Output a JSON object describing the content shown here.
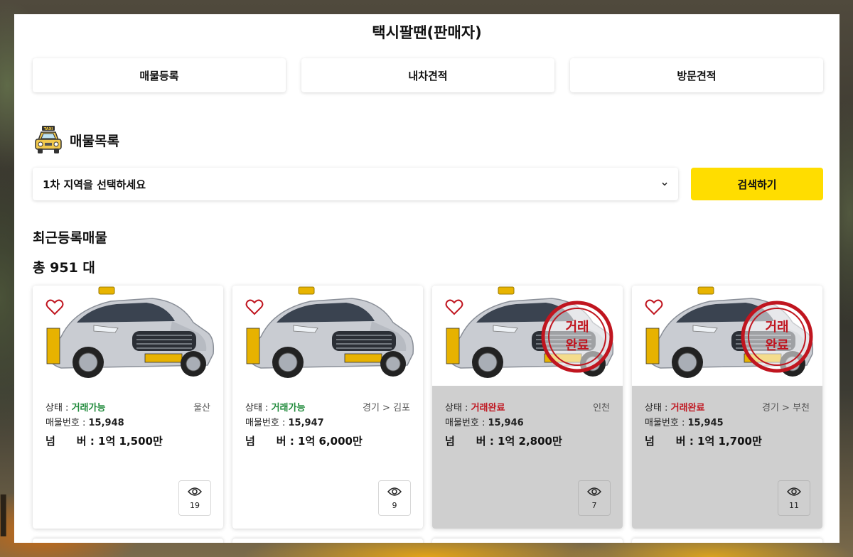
{
  "header": {
    "title": "택시팔땐(판매자)"
  },
  "tabs": [
    {
      "label": "매물등록"
    },
    {
      "label": "내차견적"
    },
    {
      "label": "방문견적"
    }
  ],
  "listing_section": {
    "title": "매물목록",
    "icon": "taxi-icon"
  },
  "filter": {
    "region_selected": "1차 지역을 선택하세요",
    "search_label": "검색하기"
  },
  "recent": {
    "title": "최근등록매물",
    "total_label": "총 951 대"
  },
  "labels": {
    "status": "상태 : ",
    "listing_no": "매물번호 : ",
    "plate": "넘　　버 : "
  },
  "stamp_text": {
    "line1": "거래",
    "line2": "완료"
  },
  "cards": [
    {
      "status": "거래가능",
      "region": "울산",
      "listing_no": "15,948",
      "price": "1억 1,500만",
      "views": "19",
      "sold": false
    },
    {
      "status": "거래가능",
      "region": "경기 > 김포",
      "listing_no": "15,947",
      "price": "1억 6,000만",
      "views": "9",
      "sold": false
    },
    {
      "status": "거래완료",
      "region": "인천",
      "listing_no": "15,946",
      "price": "1억 2,800만",
      "views": "7",
      "sold": true
    },
    {
      "status": "거래완료",
      "region": "경기 > 부천",
      "listing_no": "15,945",
      "price": "1억 1,700만",
      "views": "11",
      "sold": true
    }
  ],
  "colors": {
    "accent": "#ffdd00",
    "available": "#1f8a3a",
    "sold": "#c0151f"
  }
}
